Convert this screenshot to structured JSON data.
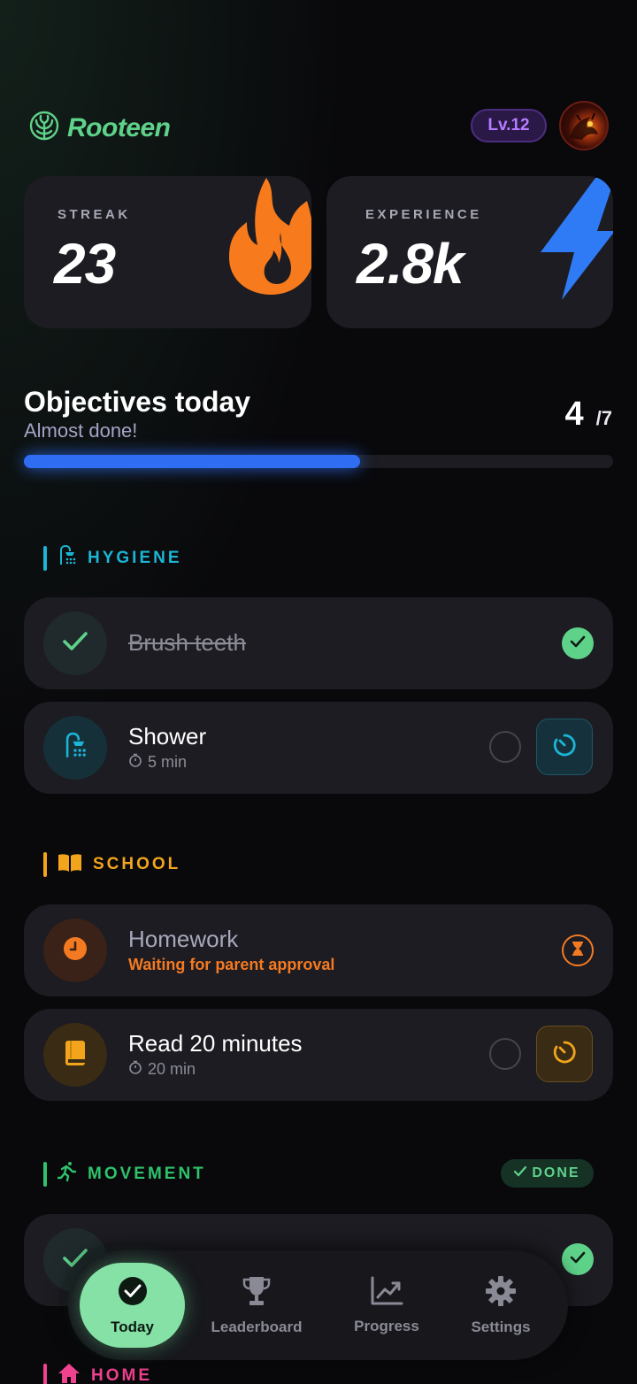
{
  "app": {
    "name": "Rooteen",
    "level": "Lv.12"
  },
  "stats": {
    "streak": {
      "label": "STREAK",
      "value": "23"
    },
    "experience": {
      "label": "EXPERIENCE",
      "value": "2.8k"
    }
  },
  "objectives": {
    "title": "Objectives today",
    "subtitle": "Almost done!",
    "done": "4",
    "total": "/7",
    "progress_fraction": 0.571
  },
  "sections": {
    "hygiene": {
      "label": "HYGIENE",
      "color": "#1cb5d6"
    },
    "school": {
      "label": "SCHOOL",
      "color": "#f2a51c"
    },
    "movement": {
      "label": "MOVEMENT",
      "color": "#2ec26b",
      "badge": "DONE"
    },
    "home": {
      "label": "HOME",
      "color": "#f0428f"
    }
  },
  "tasks": {
    "brush_teeth": {
      "title": "Brush teeth",
      "status": "completed"
    },
    "shower": {
      "title": "Shower",
      "duration": "5 min",
      "status": "pending"
    },
    "homework": {
      "title": "Homework",
      "status_text": "Waiting for parent approval"
    },
    "read": {
      "title": "Read 20 minutes",
      "duration": "20 min",
      "status": "pending"
    },
    "movement_task": {
      "status": "completed"
    }
  },
  "nav": {
    "today": "Today",
    "leaderboard": "Leaderboard",
    "progress": "Progress",
    "settings": "Settings"
  },
  "colors": {
    "brand": "#5fd28a",
    "accent_blue": "#2f6ef2",
    "level_purple": "#b57cff",
    "streak_orange": "#f77b1c",
    "xp_blue": "#2f7bf6",
    "homework_orange": "#f47a22"
  }
}
